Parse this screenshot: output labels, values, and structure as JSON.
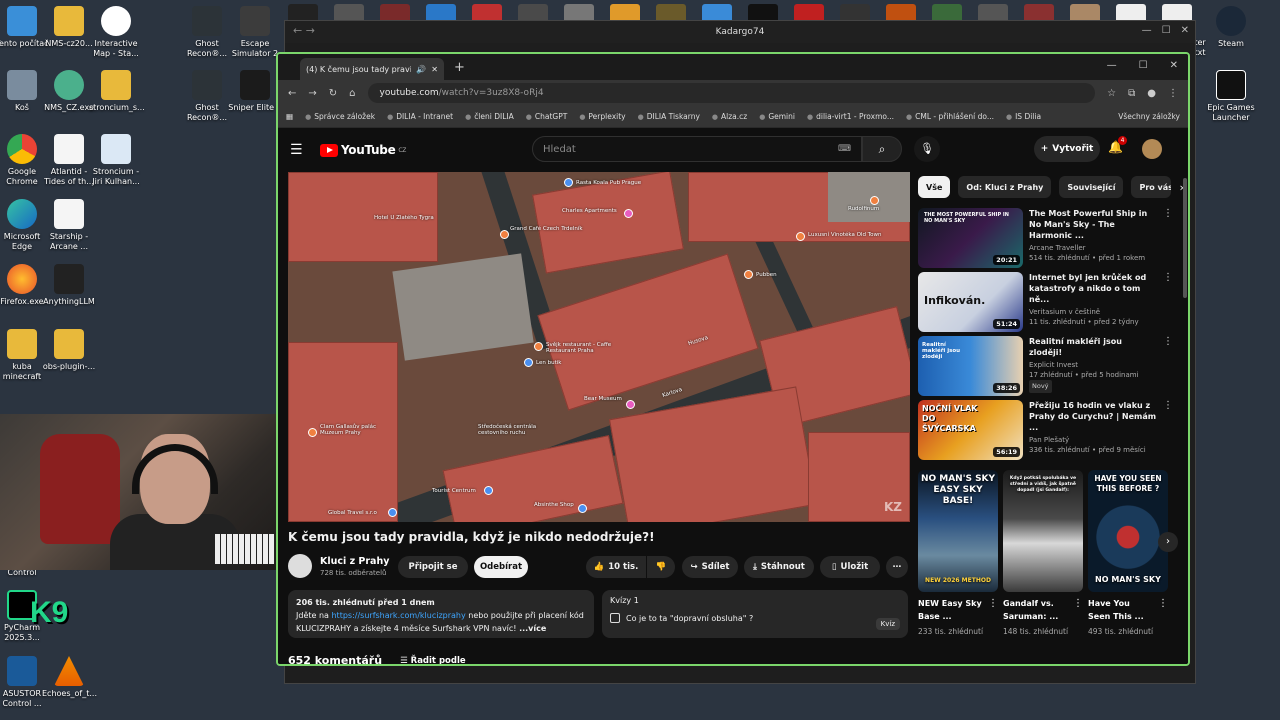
{
  "desktop": {
    "icons": [
      {
        "label": "Tento počítač"
      },
      {
        "label": "NMS-cz20..."
      },
      {
        "label": "Interactive Map - Sta..."
      },
      {
        "label": "Koš"
      },
      {
        "label": "NMS_CZ.exe"
      },
      {
        "label": "stroncium_s..."
      },
      {
        "label": "Google Chrome"
      },
      {
        "label": "Atlantid - Tides of th..."
      },
      {
        "label": "Stroncium - Jiri Kulhan..."
      },
      {
        "label": "Microsoft Edge"
      },
      {
        "label": "Starship - Arcane ..."
      },
      {
        "label": "Firefox.exe"
      },
      {
        "label": "AnythingLLM"
      },
      {
        "label": "kuba minecraft"
      },
      {
        "label": "obs-plugin-..."
      },
      {
        "label": "Ghost Recon®..."
      },
      {
        "label": "Escape Simulator 2"
      },
      {
        "label": "Ghost Recon®..."
      },
      {
        "label": "Sniper Elite 5"
      },
      {
        "label": "Control"
      },
      {
        "label": "PyCharm 2025.3..."
      },
      {
        "label": "ASUSTOR Control ..."
      },
      {
        "label": "Echoes_of_t..."
      },
      {
        "label": "Steam"
      },
      {
        "label": "Epic Games Launcher"
      },
      {
        "label": "ter"
      },
      {
        "label": "txt"
      }
    ]
  },
  "outer_window": {
    "title": "Kadargo74"
  },
  "browser": {
    "tab_title": "(4) K čemu jsou tady pravid",
    "url_host": "youtube.com",
    "url_rest": "/watch?v=3uz8X8-oRj4",
    "bookmarks": [
      "Správce záložek",
      "DILIA - Intranet",
      "členi DILIA",
      "ChatGPT",
      "Perplexity",
      "DILIA Tiskarny",
      "Alza.cz",
      "Gemini",
      "dilia-virt1 - Proxmo...",
      "CML - přihlášení do...",
      "IS Dilia"
    ],
    "bookmarks_all": "Všechny záložky"
  },
  "youtube": {
    "logo": "YouTube",
    "region": "CZ",
    "search_placeholder": "Hledat",
    "create_label": "Vytvořit",
    "notifications_count": "4",
    "video_title": "K čemu jsou tady pravidla, když je nikdo nedodržuje?!",
    "channel_name": "Kluci z Prahy",
    "channel_subs": "728 tis. odběratelů",
    "join_label": "Připojit se",
    "subscribe_label": "Odebírat",
    "likes": "10 tis.",
    "share_label": "Sdílet",
    "download_label": "Stáhnout",
    "save_label": "Uložit",
    "desc_meta": "206 tis. zhlédnutí  před 1 dnem",
    "desc_line1_pre": "Jděte na ",
    "desc_link": "https://surfshark.com/klucizprahy",
    "desc_line1_post": " nebo použijte při placení kód",
    "desc_line2": "KLUCIZPRAHY a získejte 4 měsíce Surfshark VPN navíc!",
    "desc_more": "...více",
    "quiz_title": "Kvízy",
    "quiz_count": "1",
    "quiz_question": "Co je to ta \"dopravní obsluha\" ?",
    "quiz_button": "Kvíz",
    "comments": "652 komentářů",
    "sort_label": "Řadit podle",
    "chips": [
      "Vše",
      "Od: Kluci z Prahy",
      "Související",
      "Pro vás"
    ],
    "map_labels": [
      "Rasta Koala Pub Prague",
      "Charles Apartments",
      "Hotel U Zlatého Tygra",
      "Grand Café Czech Trdelník",
      "Luxusní Vinotéka Old Town",
      "Rudolfinum",
      "Pubben",
      "Svějk restaurant - Caffe Restaurant Praha",
      "Len butik",
      "Clam Gallasův palác Muzeum Prahy",
      "Středočeská centrála cestovního ruchu",
      "Tourist Centrum",
      "Absinthe Shop",
      "Global Travel s.r.o",
      "Bear Museum",
      "Husova",
      "Karlova"
    ],
    "recommended": [
      {
        "title": "The Most Powerful Ship in No Man's Sky - The Harmonic ...",
        "channel": "Arcane Traveller",
        "meta": "514 tis. zhlédnutí • před 1 rokem",
        "duration": "20:21",
        "thumb_text": "THE MOST POWERFUL SHIP IN NO MAN'S SKY"
      },
      {
        "title": "Internet byl jen krůček od katastrofy a nikdo o tom ně...",
        "channel": "Veritasium v češtině",
        "meta": "11 tis. zhlédnutí • před 2 týdny",
        "duration": "51:24",
        "thumb_text": "Infikován."
      },
      {
        "title": "Realitní makléři jsou zloději!",
        "channel": "Explicit Invest",
        "meta": "17 zhlédnutí • před 5 hodinami",
        "duration": "38:26",
        "badge": "Nový",
        "thumb_text": "Realitní makléři jsou zloději"
      },
      {
        "title": "Přežiju 16 hodin ve vlaku z Prahy do Curychu? | Nemám ...",
        "channel": "Pan Plešatý",
        "meta": "336 tis. zhlédnutí • před 9 měsíci",
        "duration": "56:19",
        "thumb_text": "NOČNÍ VLAK DO ŠVÝCARSKA"
      }
    ],
    "shorts": [
      {
        "title": "NEW Easy Sky Base ...",
        "views": "233 tis. zhlédnutí",
        "top_text": "NO MAN'S SKY EASY SKY BASE!",
        "bottom_text": "NEW 2026 METHOD"
      },
      {
        "title": "Gandalf vs. Saruman: ...",
        "views": "148 tis. zhlédnutí",
        "top_text": "Když potkáš spolubáka ve střední a vidíš, jak špatně dopadl (jsi Gandalf):",
        "bottom_text": ""
      },
      {
        "title": "Have You Seen This ...",
        "views": "493 tis. zhlédnutí",
        "top_text": "HAVE YOU SEEN THIS BEFORE ?",
        "bottom_text": "NO MAN'S SKY"
      }
    ]
  },
  "colors": {
    "accent_green": "#7bd66b",
    "youtube_red": "#ff0000",
    "link_blue": "#3ea6ff"
  }
}
